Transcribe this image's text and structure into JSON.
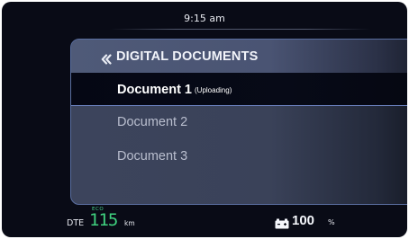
{
  "status": {
    "time": "9:15 am"
  },
  "panel": {
    "back_icon": "double-chevron-left-icon",
    "title": "DIGITAL DOCUMENTS",
    "items": [
      {
        "label": "Document 1",
        "status": "(Uploading)",
        "selected": true
      },
      {
        "label": "Document 2",
        "status": "",
        "selected": false
      },
      {
        "label": "Document 3",
        "status": "",
        "selected": false
      }
    ]
  },
  "footer": {
    "dte_label": "DTE",
    "mode_label": "ECO",
    "range_value": "115",
    "range_unit": "km",
    "battery_icon": "battery-icon",
    "battery_value": "100",
    "battery_unit": "%"
  },
  "colors": {
    "background": "#090b16",
    "accent_green": "#3fd07e",
    "selection_border": "#6f86c6",
    "panel_border": "#5a6ea0"
  }
}
